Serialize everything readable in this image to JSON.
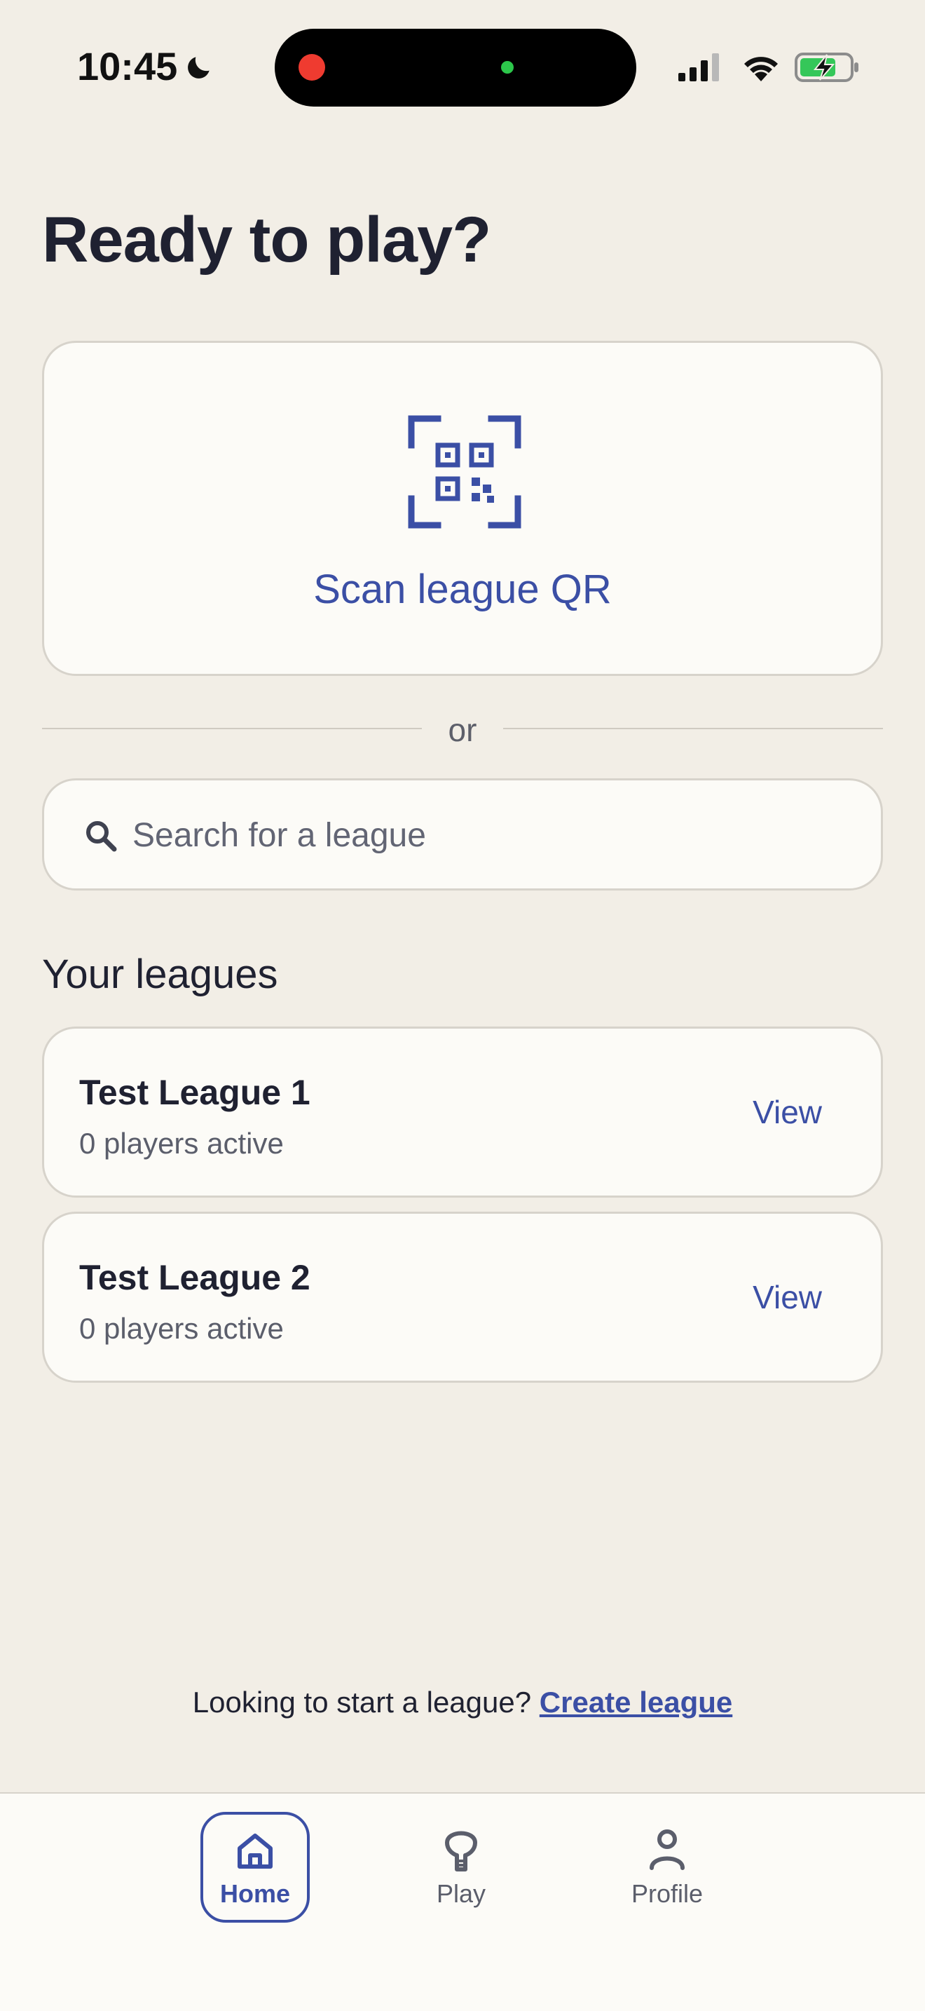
{
  "status_bar": {
    "time": "10:45",
    "icons": [
      "moon-icon",
      "signal-icon",
      "wifi-icon",
      "battery-charging-icon"
    ]
  },
  "page": {
    "title": "Ready to play?"
  },
  "scan": {
    "label": "Scan league QR",
    "icon": "qr-scan-icon"
  },
  "divider": {
    "text": "or"
  },
  "search": {
    "placeholder": "Search for a league",
    "value": ""
  },
  "leagues": {
    "section_title": "Your leagues",
    "items": [
      {
        "name": "Test League 1",
        "subtitle": "0 players active",
        "action": "View"
      },
      {
        "name": "Test League 2",
        "subtitle": "0 players active",
        "action": "View"
      }
    ]
  },
  "footer": {
    "prompt": "Looking to start a league?",
    "link": "Create league"
  },
  "tabs": [
    {
      "label": "Home",
      "icon": "home-icon",
      "active": true
    },
    {
      "label": "Play",
      "icon": "paddle-icon",
      "active": false
    },
    {
      "label": "Profile",
      "icon": "person-icon",
      "active": false
    }
  ],
  "colors": {
    "background": "#f2eee6",
    "card": "#fcfbf7",
    "accent": "#3b4fa5",
    "text": "#1f2131",
    "muted": "#5b5e6b"
  }
}
